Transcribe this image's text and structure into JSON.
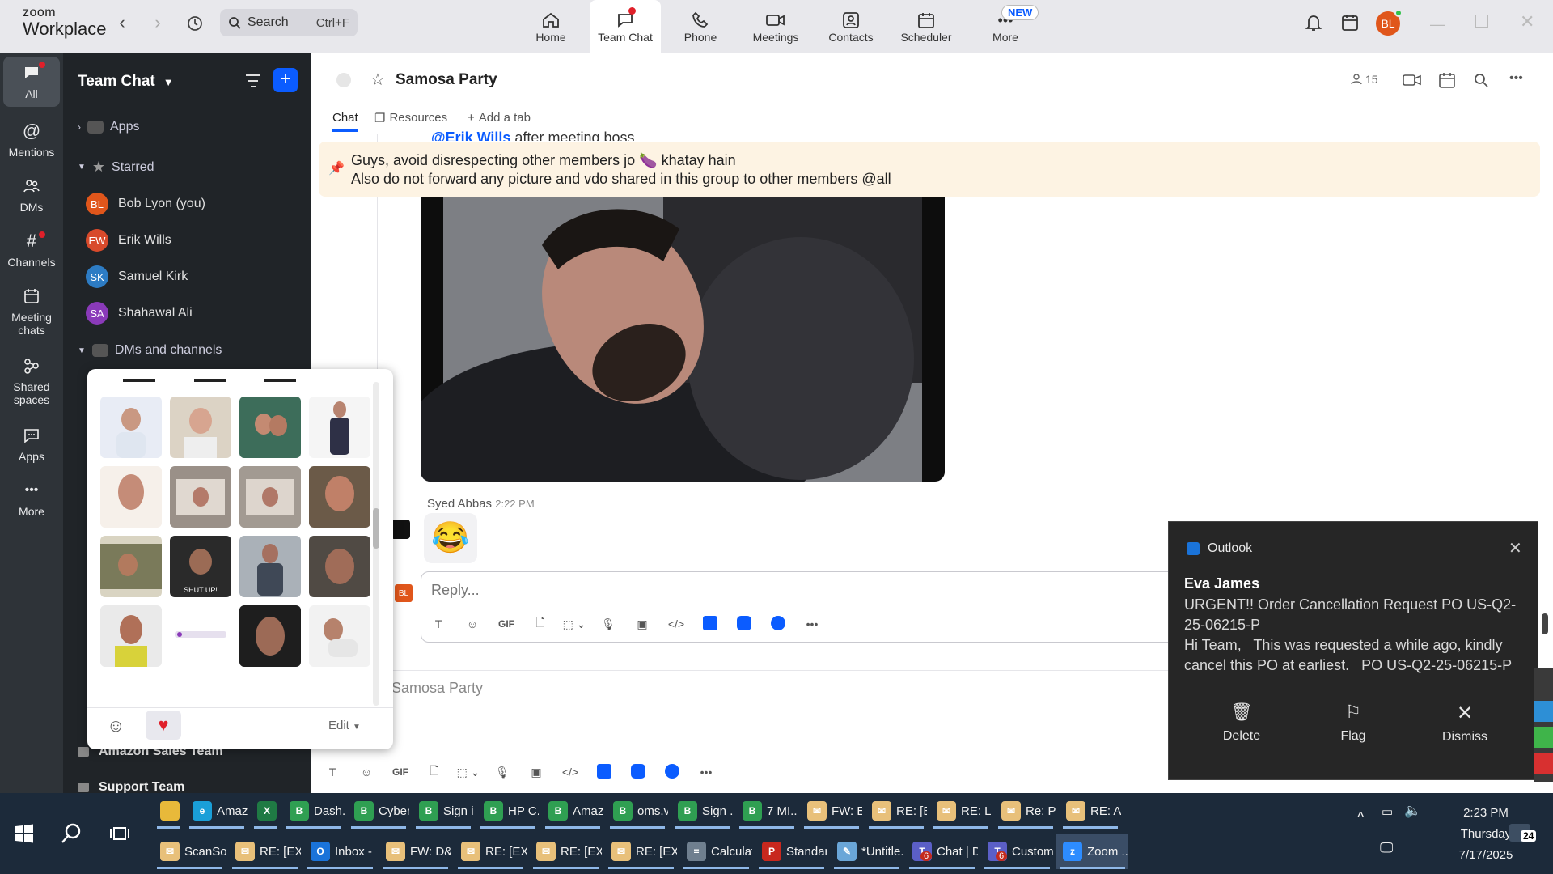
{
  "app": {
    "brand_small": "zoom",
    "brand_big": "Workplace"
  },
  "search": {
    "label": "Search",
    "shortcut": "Ctrl+F"
  },
  "top_tabs": [
    {
      "label": "Home",
      "icon": "home-icon"
    },
    {
      "label": "Team Chat",
      "icon": "chat-icon"
    },
    {
      "label": "Phone",
      "icon": "phone-icon"
    },
    {
      "label": "Meetings",
      "icon": "video-icon"
    },
    {
      "label": "Contacts",
      "icon": "contacts-icon"
    },
    {
      "label": "Scheduler",
      "icon": "calendar-icon"
    },
    {
      "label": "More",
      "icon": "more-icon"
    }
  ],
  "new_badge": "NEW",
  "user_avatar": "BL",
  "rail": [
    {
      "label": "All"
    },
    {
      "label": "Mentions"
    },
    {
      "label": "DMs"
    },
    {
      "label": "Channels"
    },
    {
      "label": "Meeting chats"
    },
    {
      "label": "Shared spaces"
    },
    {
      "label": "Apps"
    },
    {
      "label": "More"
    }
  ],
  "panel": {
    "title": "Team Chat",
    "apps": "Apps",
    "starred": "Starred",
    "people": [
      {
        "initials": "BL",
        "name": "Bob Lyon (you)",
        "color": "#e0561b"
      },
      {
        "initials": "EW",
        "name": "Erik Wills",
        "color": "#d84a2b"
      },
      {
        "initials": "SK",
        "name": "Samuel Kirk",
        "color": "#2d7cc4"
      },
      {
        "initials": "SA",
        "name": "Shahawal Ali",
        "color": "#8a3ab9"
      }
    ],
    "dms_channels": "DMs and channels",
    "bottom_items": [
      "Amazon Sales Team",
      "Support Team"
    ]
  },
  "channel": {
    "name": "Samosa Party",
    "member_count": "15",
    "tabs": [
      "Chat",
      "Resources",
      "Add a tab"
    ],
    "partial_message_mention": "@Erik Wills",
    "partial_message_text": " after meeting boss",
    "pinned_line1": "Guys, avoid disrespecting other members jo 🍆 khatay hain",
    "pinned_line2": "Also do not forward any picture and vdo shared in this group to other members @all",
    "message_author": "Syed Abbas",
    "message_time": "2:22 PM",
    "message_emoji": "😂",
    "reply_placeholder": "Reply...",
    "reply_avatar": "BL",
    "compose_placeholder": "Samosa Party"
  },
  "picker": {
    "edit_label": "Edit"
  },
  "toast": {
    "app": "Outlook",
    "sender": "Eva James",
    "subject": "URGENT!! Order Cancellation Request PO US-Q2-25-06215-P",
    "body": "Hi Team,   This was requested a while ago, kindly cancel this PO at earliest.   PO US-Q2-25-06215-P",
    "actions": [
      "Delete",
      "Flag",
      "Dismiss"
    ]
  },
  "taskbar": {
    "row1": [
      {
        "label": "",
        "kind": "folder"
      },
      {
        "label": "Amaz...",
        "kind": "edge"
      },
      {
        "label": "",
        "kind": "excel"
      },
      {
        "label": "Dash...",
        "kind": "chrome"
      },
      {
        "label": "Cyber...",
        "kind": "chrome"
      },
      {
        "label": "Sign i...",
        "kind": "chrome"
      },
      {
        "label": "HP C...",
        "kind": "chrome"
      },
      {
        "label": "Amaz...",
        "kind": "chrome"
      },
      {
        "label": "oms.v...",
        "kind": "chrome"
      },
      {
        "label": "Sign ...",
        "kind": "chrome"
      },
      {
        "label": "7 MI...",
        "kind": "chrome"
      },
      {
        "label": "FW: E...",
        "kind": "mail"
      },
      {
        "label": "RE: [E...",
        "kind": "mail"
      },
      {
        "label": "RE: La...",
        "kind": "mail"
      },
      {
        "label": "Re: P...",
        "kind": "mail"
      },
      {
        "label": "RE: A...",
        "kind": "mail"
      }
    ],
    "row2": [
      {
        "label": "ScanSo...",
        "kind": "mail"
      },
      {
        "label": "RE: [EX...",
        "kind": "mail"
      },
      {
        "label": "Inbox - ...",
        "kind": "outlook"
      },
      {
        "label": "FW: D&...",
        "kind": "mail"
      },
      {
        "label": "RE: [EX...",
        "kind": "mail"
      },
      {
        "label": "RE: [EX...",
        "kind": "mail"
      },
      {
        "label": "RE: [EX...",
        "kind": "mail"
      },
      {
        "label": "Calculat...",
        "kind": "calc"
      },
      {
        "label": "Standar...",
        "kind": "pdf"
      },
      {
        "label": "*Untitle...",
        "kind": "paint"
      },
      {
        "label": "Chat | D...",
        "kind": "teams",
        "badge": "6"
      },
      {
        "label": "Custom...",
        "kind": "teams",
        "badge": "6"
      },
      {
        "label": "Zoom ...",
        "kind": "zoom"
      }
    ],
    "time": "2:23 PM",
    "day": "Thursday",
    "date": "7/17/2025",
    "notif_count": "24"
  },
  "colors": {
    "accent": "#0b5cff",
    "toast_bg": "#262626",
    "pinned_bg": "#fdf3e3"
  }
}
